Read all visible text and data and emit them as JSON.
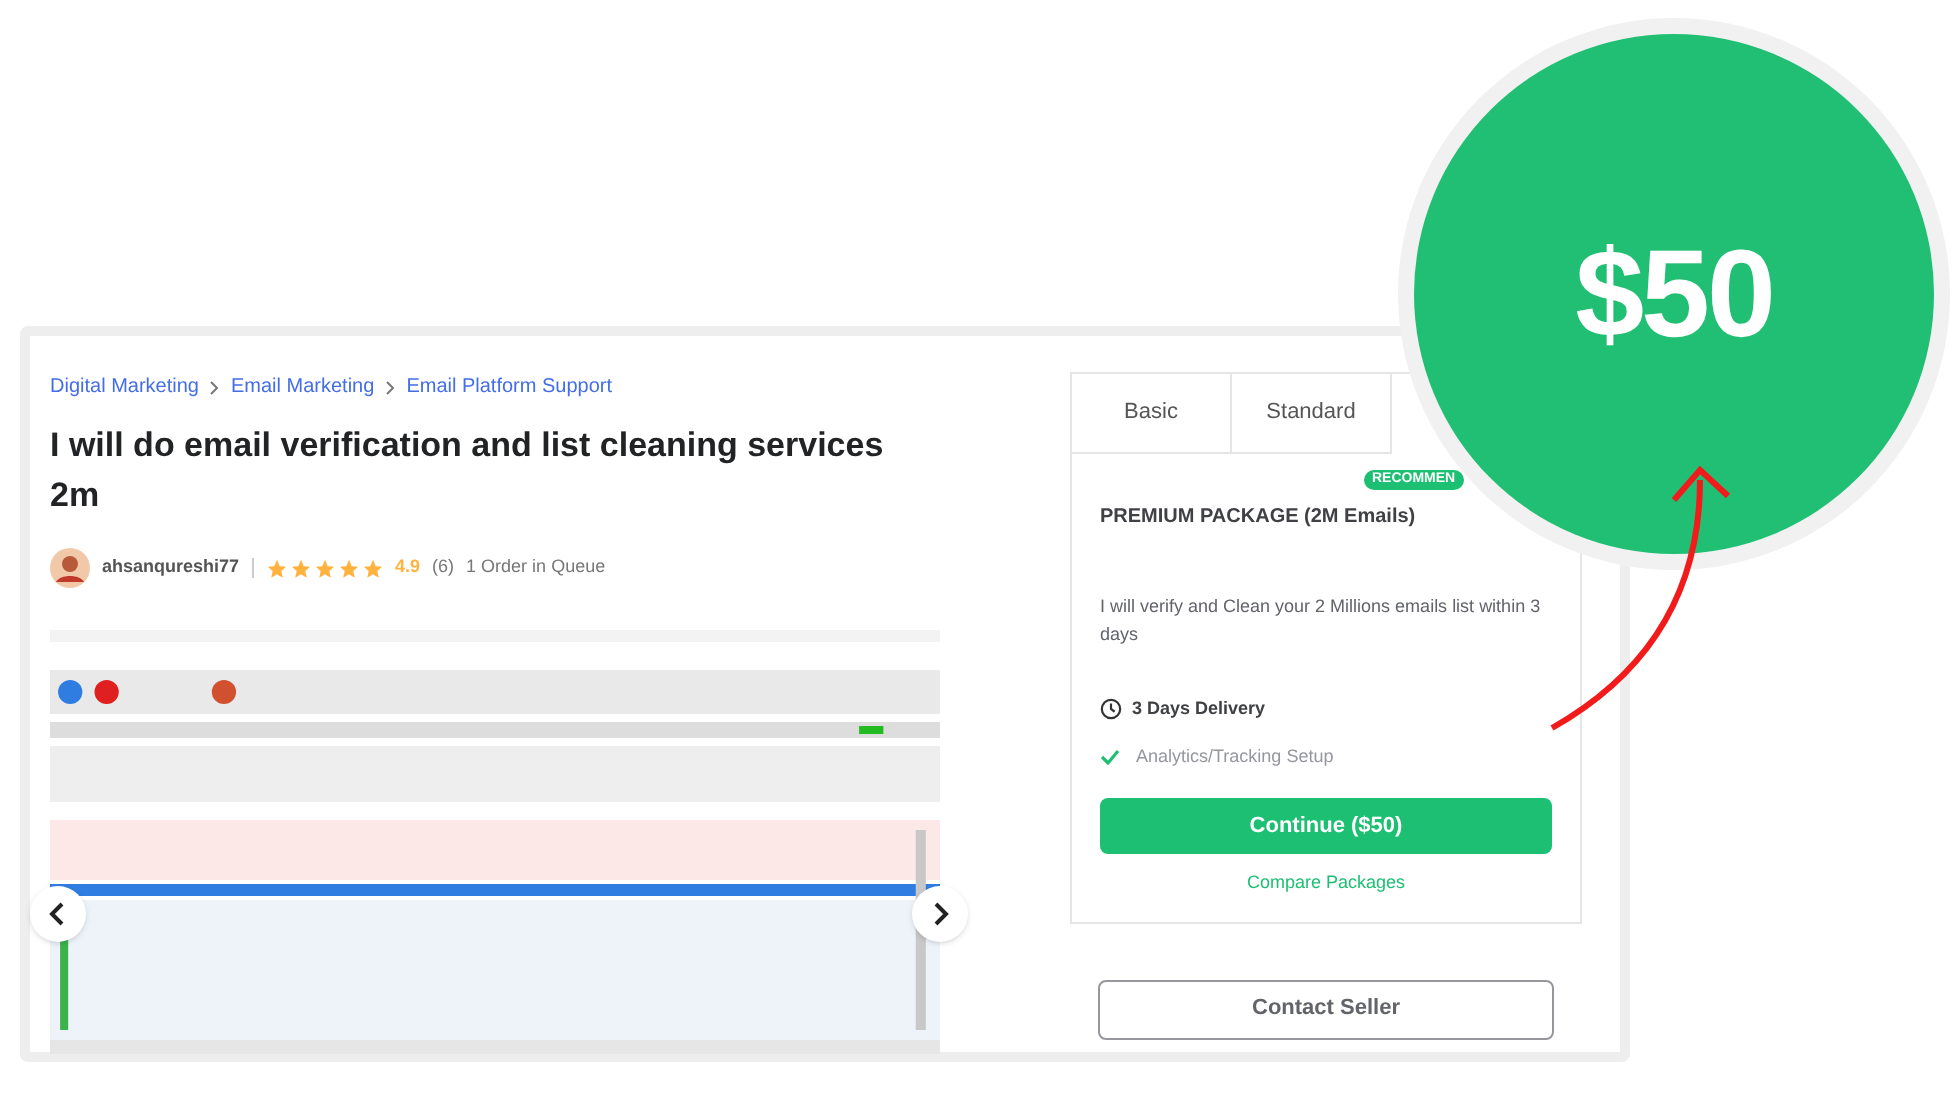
{
  "breadcrumbs": [
    "Digital Marketing",
    "Email Marketing",
    "Email Platform Support"
  ],
  "gig": {
    "title": "I will do email verification and list cleaning services 2m",
    "seller": "ahsanqureshi77",
    "stars": 5,
    "rating": "4.9",
    "reviews": "(6)",
    "queue": "1 Order in Queue"
  },
  "package_tabs": [
    {
      "label": "Basic",
      "selected": false
    },
    {
      "label": "Standard",
      "selected": false
    }
  ],
  "package": {
    "badge": "RECOMMEN",
    "name": "PREMIUM PACKAGE (2M Emails)",
    "description": "I will verify and Clean your 2 Millions emails list within 3 days",
    "delivery": "3 Days Delivery",
    "features": [
      {
        "label": "Analytics/Tracking Setup",
        "included": true
      }
    ],
    "continue_button": "Continue ($50)",
    "compare_link": "Compare Packages"
  },
  "contact_button": "Contact Seller",
  "price_callout": "$50"
}
